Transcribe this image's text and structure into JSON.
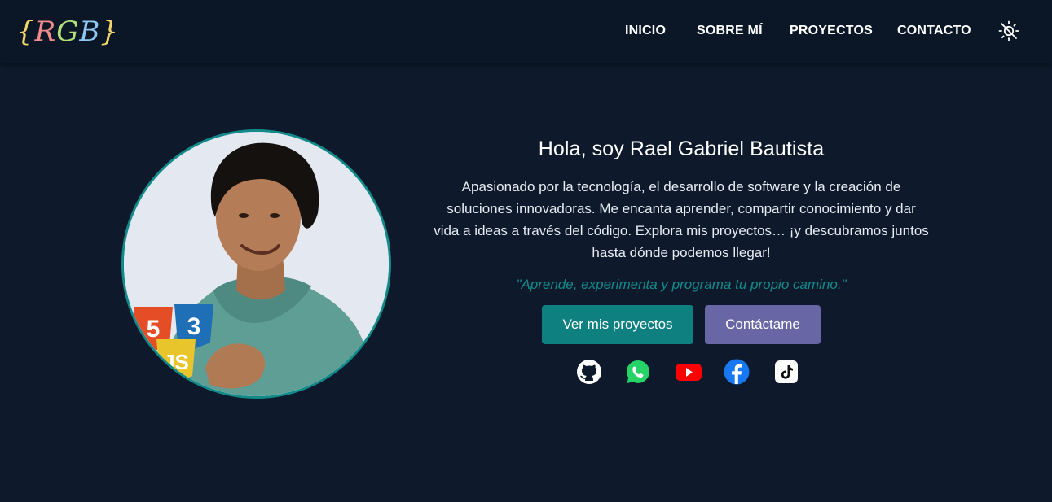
{
  "navbar": {
    "logo": {
      "letters": [
        "{",
        "R",
        "G",
        "B",
        "}"
      ],
      "letter_colors": [
        "#f3d46b",
        "#f28b8b",
        "#b3e07a",
        "#8ec8f0",
        "#f3d46b"
      ]
    },
    "links": [
      {
        "label": "INICIO"
      },
      {
        "label": "SOBRE MÍ"
      },
      {
        "label": "PROYECTOS"
      },
      {
        "label": "CONTACTO"
      }
    ],
    "theme_toggle_icon": "sun-off-icon"
  },
  "hero": {
    "avatar_icon": "profile-photo",
    "title": "Hola, soy Rael Gabriel Bautista",
    "description": "Apasionado por la tecnología, el desarrollo de software y la creación de soluciones innovadoras. Me encanta aprender, compartir conocimiento y dar vida a ideas a través del código. Explora mis proyectos… ¡y descubramos juntos hasta dónde podemos llegar!",
    "quote": "\"Aprende, experimenta y programa tu propio camino.\"",
    "buttons": {
      "primary": "Ver mis proyectos",
      "secondary": "Contáctame"
    },
    "social": [
      {
        "icon": "github-icon",
        "color": "#ffffff"
      },
      {
        "icon": "whatsapp-icon",
        "color": "#25d366"
      },
      {
        "icon": "youtube-icon",
        "color": "#ff0000"
      },
      {
        "icon": "facebook-icon",
        "color": "#1877f2"
      },
      {
        "icon": "tiktok-icon",
        "color": "#ffffff"
      }
    ]
  },
  "colors": {
    "background": "#0e1a2b",
    "navbar": "#0b1727",
    "accent": "#138a8a",
    "secondary_button": "#6966a6"
  }
}
